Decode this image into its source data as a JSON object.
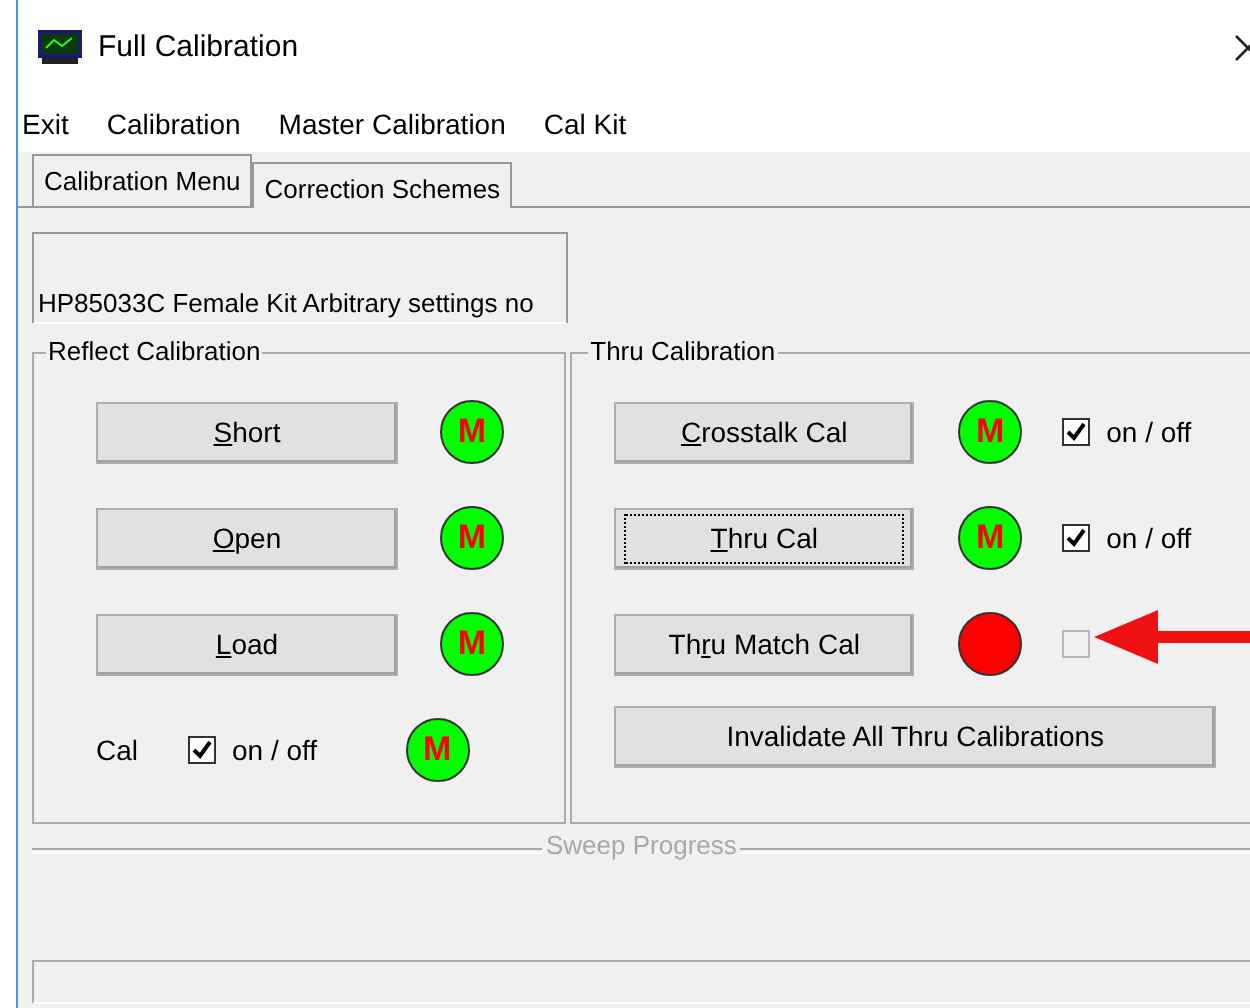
{
  "window": {
    "title": "Full Calibration"
  },
  "menu": [
    "Exit",
    "Calibration",
    "Master Calibration",
    "Cal Kit"
  ],
  "tabs": [
    {
      "label": "Calibration Menu",
      "selected": true
    },
    {
      "label": "Correction Schemes",
      "selected": false
    }
  ],
  "kit_name": "HP85033C Female Kit Arbitrary settings no",
  "reflect": {
    "title": "Reflect Calibration",
    "rows": [
      {
        "button": {
          "key": "S",
          "rest": "hort"
        },
        "indicator": {
          "color": "#00ff00",
          "mark": "M"
        }
      },
      {
        "button": {
          "key": "O",
          "rest": "pen"
        },
        "indicator": {
          "color": "#00ff00",
          "mark": "M"
        }
      },
      {
        "button": {
          "key": "L",
          "rest": "oad"
        },
        "indicator": {
          "color": "#00ff00",
          "mark": "M"
        }
      }
    ],
    "cal": {
      "label": "Cal",
      "checkbox": {
        "label": "on / off",
        "checked": true,
        "disabled": false
      },
      "indicator": {
        "color": "#00ff00",
        "mark": "M"
      }
    }
  },
  "thru": {
    "title": "Thru Calibration",
    "rows": [
      {
        "button": {
          "key": "C",
          "rest": "rosstalk Cal",
          "focused": false
        },
        "indicator": {
          "color": "#00ff00",
          "mark": "M"
        },
        "checkbox": {
          "label": "on / off",
          "checked": true,
          "disabled": false
        }
      },
      {
        "button": {
          "key": "T",
          "rest": "hru Cal",
          "focused": true
        },
        "indicator": {
          "color": "#00ff00",
          "mark": "M"
        },
        "checkbox": {
          "label": "on / off",
          "checked": true,
          "disabled": false
        }
      },
      {
        "button": {
          "pre": "Th",
          "key": "r",
          "rest": "u Match Cal",
          "focused": false
        },
        "indicator": {
          "color": "#ff0000"
        },
        "checkbox": {
          "checked": false,
          "disabled": true
        }
      }
    ],
    "invalidate": "Invalidate All Thru Calibrations"
  },
  "progress": {
    "title": "Sweep Progress"
  }
}
